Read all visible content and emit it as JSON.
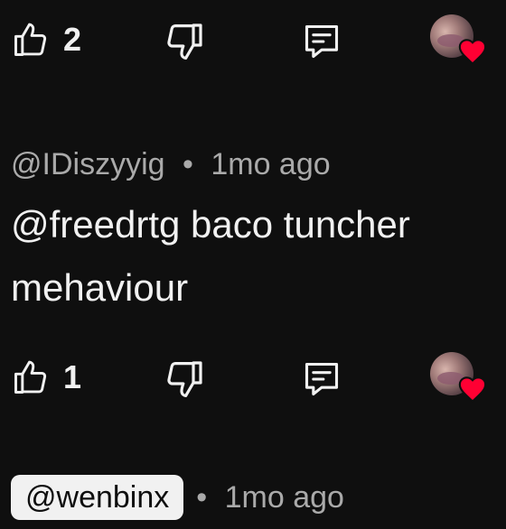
{
  "comment_actions_top": {
    "like_count": "2"
  },
  "comment": {
    "author": "@IDiszyyig",
    "separator": "•",
    "time": "1mo ago",
    "body": "@freedrtg baco tuncher\nmehaviour"
  },
  "comment_actions": {
    "like_count": "1"
  },
  "next_comment": {
    "author": "@wenbinx",
    "separator": "•",
    "time": "1mo ago"
  },
  "icons": {
    "like": "thumbs-up-icon",
    "dislike": "thumbs-down-icon",
    "reply": "reply-icon",
    "creator_heart": "heart-icon"
  },
  "colors": {
    "background": "#0f0f0f",
    "text": "#f1f1f1",
    "secondary_text": "#aaaaaa",
    "heart": "#ff0033"
  }
}
